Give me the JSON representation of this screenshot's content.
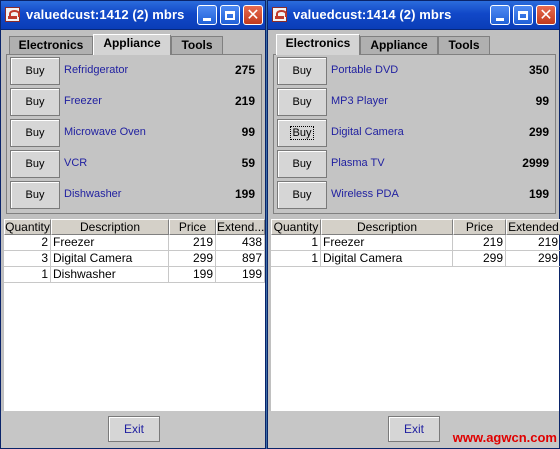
{
  "left": {
    "title": "valuedcust:1412 (2) mbrs",
    "tabs": [
      "Electronics",
      "Appliance",
      "Tools"
    ],
    "active_tab": "Appliance",
    "products": [
      {
        "buy": "Buy",
        "name": "Refridgerator",
        "price": "275"
      },
      {
        "buy": "Buy",
        "name": "Freezer",
        "price": "219"
      },
      {
        "buy": "Buy",
        "name": "Microwave Oven",
        "price": "99"
      },
      {
        "buy": "Buy",
        "name": "VCR",
        "price": "59"
      },
      {
        "buy": "Buy",
        "name": "Dishwasher",
        "price": "199"
      }
    ],
    "columns": [
      "Quantity",
      "Description",
      "Price",
      "Extend..."
    ],
    "rows": [
      [
        "2",
        "Freezer",
        "219",
        "438"
      ],
      [
        "3",
        "Digital Camera",
        "299",
        "897"
      ],
      [
        "1",
        "Dishwasher",
        "199",
        "199"
      ]
    ],
    "exit": "Exit"
  },
  "right": {
    "title": "valuedcust:1414 (2) mbrs",
    "tabs": [
      "Electronics",
      "Appliance",
      "Tools"
    ],
    "active_tab": "Electronics",
    "products": [
      {
        "buy": "Buy",
        "name": "Portable DVD",
        "price": "350"
      },
      {
        "buy": "Buy",
        "name": "MP3 Player",
        "price": "99"
      },
      {
        "buy": "Buy",
        "name": "Digital Camera",
        "price": "299"
      },
      {
        "buy": "Buy",
        "name": "Plasma TV",
        "price": "2999"
      },
      {
        "buy": "Buy",
        "name": "Wireless PDA",
        "price": "199"
      }
    ],
    "columns": [
      "Quantity",
      "Description",
      "Price",
      "Extended"
    ],
    "rows": [
      [
        "1",
        "Freezer",
        "219",
        "219"
      ],
      [
        "1",
        "Digital Camera",
        "299",
        "299"
      ]
    ],
    "exit": "Exit"
  },
  "watermark": "www.agwcn.com",
  "colors": {
    "titlebar": "#0a3db7",
    "link_text": "#1f1fa0",
    "watermark": "#e00000"
  }
}
